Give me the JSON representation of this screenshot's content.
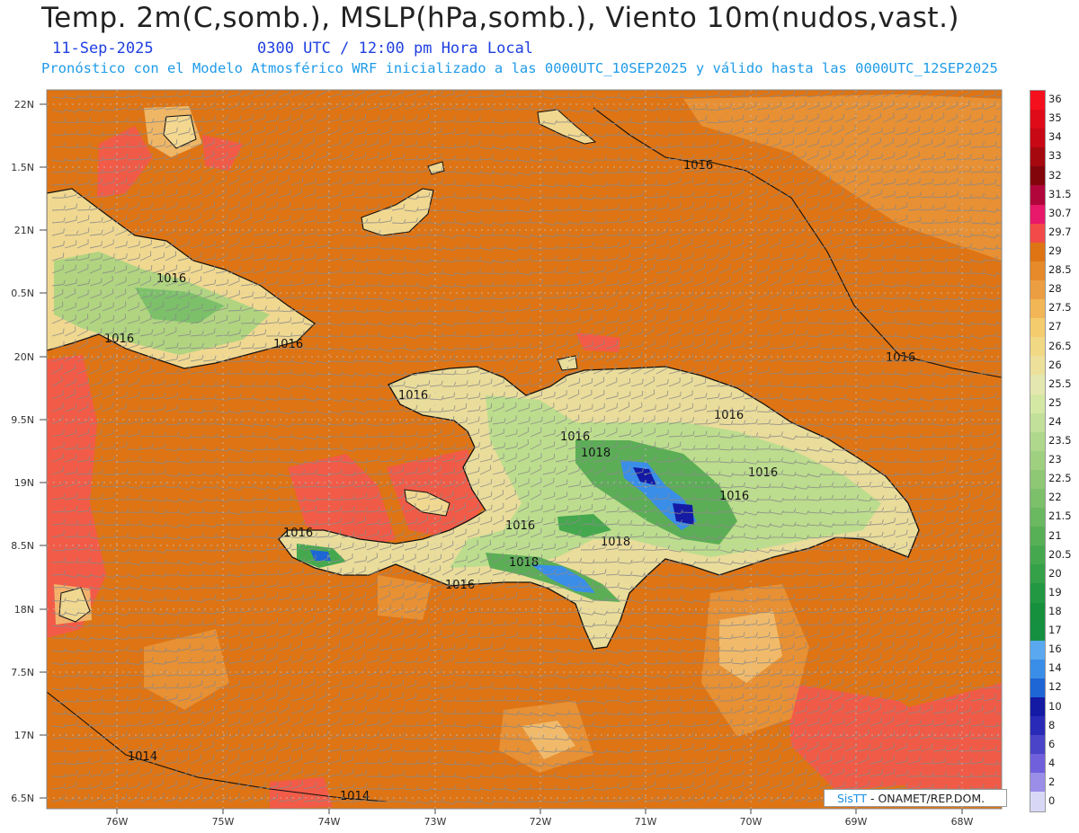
{
  "title": "Temp. 2m(C,somb.), MSLP(hPa,somb.), Viento 10m(nudos,vast.)",
  "subtitle_date": "11-Sep-2025",
  "subtitle_time": "0300 UTC / 12:00 pm Hora Local",
  "subtitle_model": "Pronóstico con el Modelo Atmosférico WRF inicializado a las 0000UTC_10SEP2025 y válido hasta las  0000UTC_12SEP2025",
  "lat_labels": [
    "22N",
    "1.5N",
    "21N",
    "0.5N",
    "20N",
    "9.5N",
    "19N",
    "8.5N",
    "18N",
    "7.5N",
    "17N",
    "6.5N"
  ],
  "lon_labels": [
    "76W",
    "75W",
    "74W",
    "73W",
    "72W",
    "71W",
    "70W",
    "69W",
    "68W"
  ],
  "isobar_labels": [
    "1016",
    "1016",
    "1016",
    "1016",
    "1016",
    "1016",
    "1016",
    "1016",
    "1016",
    "1016",
    "1016",
    "1016",
    "1016",
    "1018",
    "1018",
    "1018",
    "1014",
    "1014"
  ],
  "legend": {
    "labels": [
      "36",
      "35",
      "34",
      "33",
      "32",
      "31.5",
      "30.7",
      "29.7",
      "29",
      "28.5",
      "28",
      "27.5",
      "27",
      "26.5",
      "26",
      "25.5",
      "25",
      "24",
      "23.5",
      "23",
      "22.5",
      "22",
      "21.5",
      "21",
      "20.5",
      "20",
      "19",
      "18",
      "17",
      "16",
      "14",
      "12",
      "10",
      "8",
      "6",
      "4",
      "2",
      "0"
    ],
    "colors": [
      "#f5101e",
      "#e00b18",
      "#c80814",
      "#a60810",
      "#82050c",
      "#b0063c",
      "#e8186a",
      "#f24a48",
      "#de7414",
      "#e68a2a",
      "#ec9e42",
      "#f2b656",
      "#f4cc6e",
      "#f0d884",
      "#ede09a",
      "#e4e8b0",
      "#d4e8a4",
      "#c2e09a",
      "#b0d88c",
      "#9fd080",
      "#8ec874",
      "#7cc06a",
      "#6ab860",
      "#58b056",
      "#46a84e",
      "#34a048",
      "#229842",
      "#16903c",
      "#149040",
      "#5aa8f0",
      "#3a8ee8",
      "#1e66d6",
      "#141aa4",
      "#2a2ab8",
      "#4a44c8",
      "#7060dc",
      "#9a8ee8",
      "#d8d8f6"
    ]
  },
  "credit": {
    "brand": "SisTT",
    "rest": "- ONAMET/REP.DOM."
  },
  "colors": {
    "background_sea": "#de7414",
    "warm_patch": "#f25a4a",
    "coast_line": "#111111",
    "wind_barbs": "#8a8a8a"
  }
}
